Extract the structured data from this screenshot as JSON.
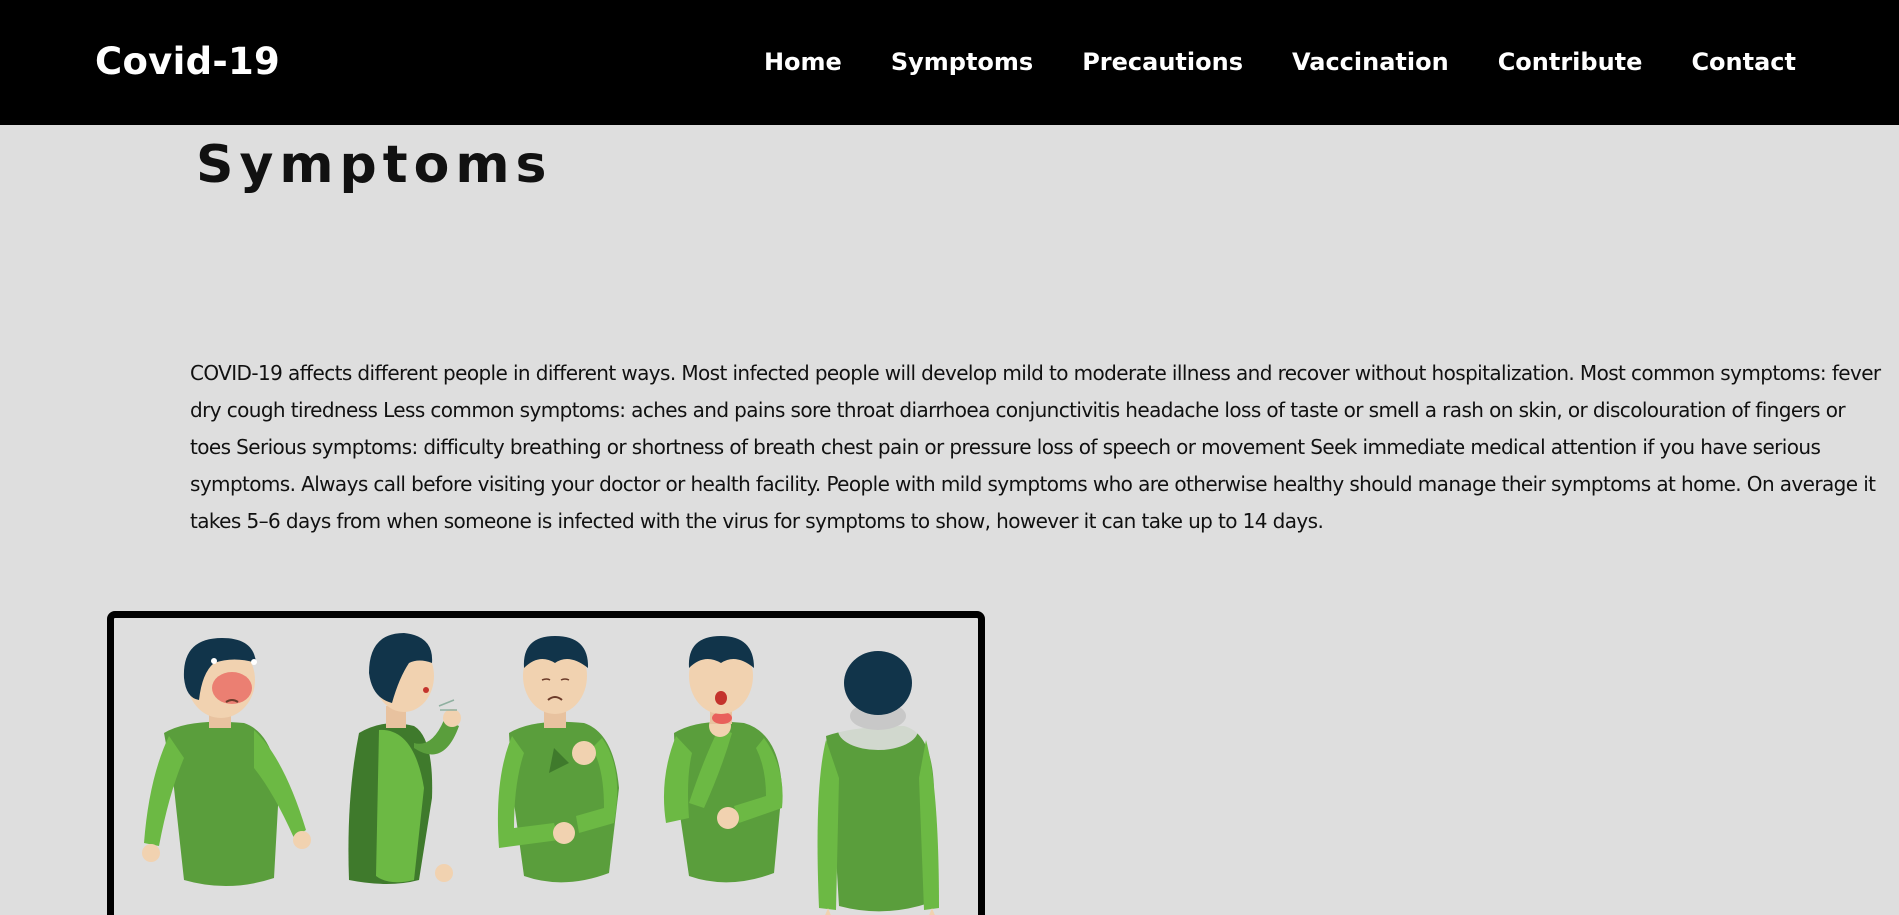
{
  "header": {
    "brand": "Covid-19",
    "nav": [
      {
        "label": "Home"
      },
      {
        "label": "Symptoms"
      },
      {
        "label": "Precautions"
      },
      {
        "label": "Vaccination"
      },
      {
        "label": "Contribute"
      },
      {
        "label": "Contact"
      }
    ]
  },
  "main": {
    "title": "Symptoms",
    "intro": "COVID-19 affects different people in different ways. Most infected people will develop mild to moderate illness and recover without hospitalization. Most common symptoms: fever dry cough tiredness Less common symptoms: aches and pains sore throat diarrhoea conjunctivitis headache loss of taste or smell a rash on skin, or discolouration of fingers or toes Serious symptoms: difficulty breathing or shortness of breath chest pain or pressure loss of speech or movement Seek immediate medical attention if you have serious symptoms. Always call before visiting your doctor or health facility. People with mild symptoms who are otherwise healthy should manage their symptoms at home. On average it takes 5–6 days from when someone is infected with the virus for symptoms to show, however it can take up to 14 days."
  },
  "illustration": {
    "figures": [
      "fever",
      "cough",
      "chest-pain",
      "sore-throat",
      "loss-of-speech"
    ],
    "colors": {
      "shirt": "#5a9e3c",
      "shirt_light": "#6cb944",
      "shirt_dark": "#3f7a2c",
      "hair": "#11344a",
      "skin": "#f1d2b0",
      "fever_red": "#e8474a"
    }
  }
}
